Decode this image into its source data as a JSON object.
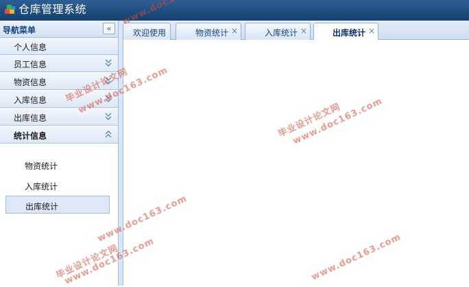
{
  "app": {
    "title": "仓库管理系统"
  },
  "nav": {
    "header": "导航菜单",
    "collapse_glyph": "«",
    "items": [
      {
        "label": "个人信息",
        "chevron": "none"
      },
      {
        "label": "员工信息",
        "chevron": "down"
      },
      {
        "label": "物资信息",
        "chevron": "down"
      },
      {
        "label": "入库信息",
        "chevron": "down"
      },
      {
        "label": "出库信息",
        "chevron": "down"
      },
      {
        "label": "统计信息",
        "chevron": "up",
        "expanded": true
      }
    ],
    "sub_items": [
      {
        "label": "物资统计"
      },
      {
        "label": "入库统计"
      },
      {
        "label": "出库统计",
        "selected": true
      }
    ]
  },
  "tabs": [
    {
      "label": "欢迎使用",
      "closable": false
    },
    {
      "label": "物资统计",
      "closable": true
    },
    {
      "label": "入库统计",
      "closable": true
    },
    {
      "label": "出库统计",
      "closable": true,
      "active": true
    }
  ],
  "tab_close_glyph": "×",
  "watermark": {
    "line1": "毕业设计论文网",
    "line2": "www.doc163.com"
  },
  "colors": {
    "title_bar": "#1d4d80",
    "accent_border": "#99bbe8",
    "watermark": "#dc4632"
  }
}
